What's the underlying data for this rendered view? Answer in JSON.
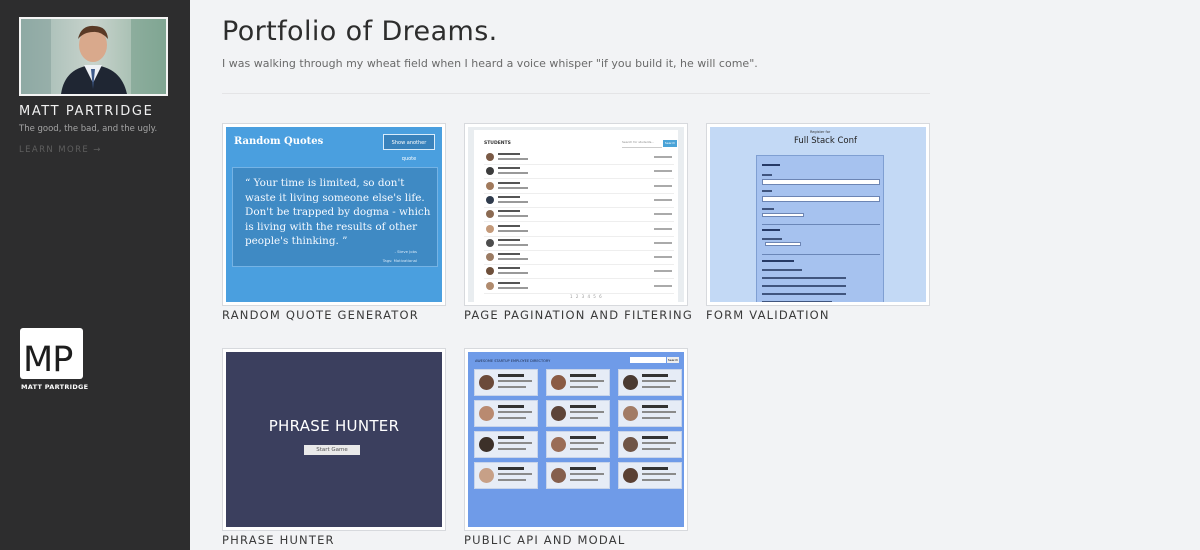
{
  "sidebar": {
    "name": "MATT PARTRIDGE",
    "tagline": "The good, the bad, and the ugly.",
    "learn_more": "LEARN MORE →",
    "logo_letters": "MP",
    "logo_caption": "MATT PARTRIDGE"
  },
  "header": {
    "title": "Portfolio of Dreams.",
    "subtitle": "I was walking through my wheat field when I heard a voice whisper \"if you build it, he will come\"."
  },
  "projects": [
    {
      "label": "RANDOM QUOTE GENERATOR",
      "thumb": {
        "title": "Random Quotes",
        "button": "Show another quote",
        "quote": "“ Your time is limited, so don't waste it living someone else's life. Don't be trapped by dogma - which is living with the results of other people's thinking. ”",
        "author": "- Steve Jobs",
        "tag": "Tags: Motivational"
      }
    },
    {
      "label": "PAGE PAGINATION AND FILTERING",
      "thumb": {
        "heading": "STUDENTS",
        "search_placeholder": "Search for students...",
        "search_button": "Search",
        "pages": "1 2 3 4 5 6"
      }
    },
    {
      "label": "FORM VALIDATION",
      "thumb": {
        "small": "Register for",
        "title": "Full Stack Conf"
      }
    },
    {
      "label": "PHRASE HUNTER",
      "thumb": {
        "title": "PHRASE HUNTER",
        "button": "Start Game"
      }
    },
    {
      "label": "PUBLIC API AND MODAL",
      "thumb": {
        "heading": "AWESOME STARTUP EMPLOYEE DIRECTORY",
        "search_button": "Search"
      }
    }
  ],
  "colors": {
    "sidebar_bg": "#2d2d2e",
    "page_bg": "#f2f3f5",
    "quote_blue": "#4a9fdf",
    "phrase_bg": "#3b3f5e",
    "api_blue": "#6f9be8"
  }
}
